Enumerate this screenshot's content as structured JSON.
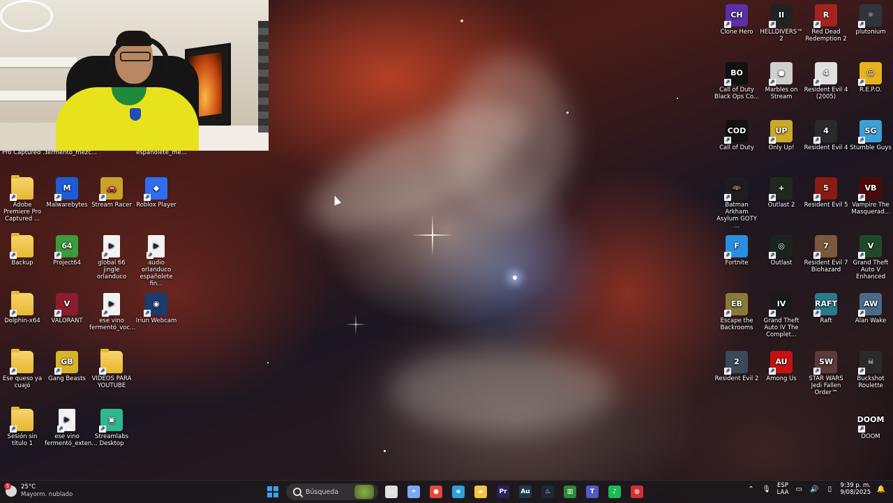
{
  "webcam": {
    "visible": true
  },
  "partial_labels": [
    "Pro Captured ...",
    "fermento_mezc...",
    "españolete_me..."
  ],
  "desktop_left": [
    {
      "label": "Adobe Premiere Pro Captured ...",
      "icon": "folder-icon",
      "type": "folder"
    },
    {
      "label": "Malwarebytes",
      "icon": "malwarebytes-icon",
      "color": "#1e5bd6",
      "glyph": "M"
    },
    {
      "label": "Stream Racer",
      "icon": "stream-racer-icon",
      "color": "#c9a22a",
      "glyph": "🚗"
    },
    {
      "label": "Roblox Player",
      "icon": "roblox-icon",
      "color": "#2f6ef0",
      "glyph": "◆"
    },
    {
      "label": "Backup",
      "icon": "folder-icon",
      "type": "folder"
    },
    {
      "label": "Project64",
      "icon": "project64-icon",
      "color": "#3a9c3a",
      "glyph": "64"
    },
    {
      "label": "global 66 jingle orlanduco",
      "icon": "audio-file-icon",
      "type": "doc",
      "glyph": "▶"
    },
    {
      "label": "audio orlanduco españolete fin...",
      "icon": "audio-file-icon",
      "type": "doc",
      "glyph": "▶"
    },
    {
      "label": "Dolphin-x64",
      "icon": "folder-icon",
      "type": "folder"
    },
    {
      "label": "VALORANT",
      "icon": "valorant-icon",
      "color": "#8b1c2c",
      "glyph": "V"
    },
    {
      "label": "ese vino fermentó_voc...",
      "icon": "audio-file-icon",
      "type": "doc",
      "glyph": "▶"
    },
    {
      "label": "Iriun Webcam",
      "icon": "iriun-webcam-icon",
      "color": "#1b3b6f",
      "glyph": "◉"
    },
    {
      "label": "Ese queso ya cuajó",
      "icon": "folder-icon",
      "type": "folder"
    },
    {
      "label": "Gang Beasts",
      "icon": "gang-beasts-icon",
      "color": "#d7b32a",
      "glyph": "GB"
    },
    {
      "label": "VIDEOS PARA YOUTUBE",
      "icon": "folder-icon",
      "type": "folder"
    },
    {
      "label": "Sesión sin título 1",
      "icon": "folder-icon",
      "type": "folder"
    },
    {
      "label": "ese vino fermentó_exten...",
      "icon": "audio-file-icon",
      "type": "doc",
      "glyph": "▶"
    },
    {
      "label": "Streamlabs Desktop",
      "icon": "streamlabs-icon",
      "color": "#2fb88f",
      "glyph": "▣"
    }
  ],
  "desktop_right": [
    {
      "label": "Clone Hero",
      "icon": "clone-hero-icon",
      "color": "#5a2fa8",
      "glyph": "CH"
    },
    {
      "label": "HELLDIVERS™ 2",
      "icon": "helldivers-icon",
      "color": "#222222",
      "glyph": "II"
    },
    {
      "label": "Red Dead Redemption 2",
      "icon": "rdr2-icon",
      "color": "#a3231f",
      "glyph": "R"
    },
    {
      "label": "plutonium",
      "icon": "plutonium-icon",
      "color": "#30343c",
      "glyph": "⚛"
    },
    {
      "label": "Call of Duty Black Ops Co...",
      "icon": "cod-bo-icon",
      "color": "#111111",
      "glyph": "BO"
    },
    {
      "label": "Marbles on Stream",
      "icon": "marbles-icon",
      "color": "#cfcfcf",
      "glyph": "●"
    },
    {
      "label": "Resident Evil 4 (2005)",
      "icon": "re4-2005-icon",
      "color": "#e0e0e0",
      "glyph": "4"
    },
    {
      "label": "R.E.P.O.",
      "icon": "repo-icon",
      "color": "#e6b31e",
      "glyph": "☺"
    },
    {
      "label": "Call of Duty",
      "icon": "cod-icon",
      "color": "#111111",
      "glyph": "COD"
    },
    {
      "label": "Only Up!",
      "icon": "only-up-icon",
      "color": "#c9a82a",
      "glyph": "UP"
    },
    {
      "label": "Resident Evil 4",
      "icon": "re4-icon",
      "color": "#2a2a2a",
      "glyph": "4"
    },
    {
      "label": "Stumble Guys",
      "icon": "stumble-guys-icon",
      "color": "#3aa0d8",
      "glyph": "SG"
    },
    {
      "label": "Batman Arkham Asylum GOTY ...",
      "icon": "batman-icon",
      "color": "#1d1d22",
      "glyph": "🦇"
    },
    {
      "label": "Outlast 2",
      "icon": "outlast2-icon",
      "color": "#1e2a1e",
      "glyph": "+"
    },
    {
      "label": "Resident Evil 5",
      "icon": "re5-icon",
      "color": "#8a1a12",
      "glyph": "5"
    },
    {
      "label": "Vampire The Masquerad...",
      "icon": "vampire-icon",
      "color": "#4a0a0a",
      "glyph": "VB"
    },
    {
      "label": "Fortnite",
      "icon": "fortnite-icon",
      "color": "#2a8fe0",
      "glyph": "F"
    },
    {
      "label": "Outlast",
      "icon": "outlast-icon",
      "color": "#1a241c",
      "glyph": "◎"
    },
    {
      "label": "Resident Evil 7 Biohazard",
      "icon": "re7-icon",
      "color": "#7a5a3a",
      "glyph": "7"
    },
    {
      "label": "Grand Theft Auto V Enhanced",
      "icon": "gtav-icon",
      "color": "#1f4a2a",
      "glyph": "V"
    },
    {
      "label": "Escape the Backrooms",
      "icon": "escape-backrooms-icon",
      "color": "#8a7a3a",
      "glyph": "EB"
    },
    {
      "label": "Grand Theft Auto IV The Complet...",
      "icon": "gtaiv-icon",
      "color": "#1a1a1a",
      "glyph": "IV"
    },
    {
      "label": "Raft",
      "icon": "raft-icon",
      "color": "#2a7a8a",
      "glyph": "RAFT"
    },
    {
      "label": "Alan Wake",
      "icon": "alan-wake-icon",
      "color": "#4a6a8a",
      "glyph": "AW"
    },
    {
      "label": "Resident Evil 2",
      "icon": "re2-icon",
      "color": "#3a4a5a",
      "glyph": "2"
    },
    {
      "label": "Among Us",
      "icon": "among-us-icon",
      "color": "#c51111",
      "glyph": "AU"
    },
    {
      "label": "STAR WARS Jedi Fallen Order™",
      "icon": "jedi-icon",
      "color": "#5a3a3a",
      "glyph": "SW"
    },
    {
      "label": "Buckshot Roulette",
      "icon": "buckshot-icon",
      "color": "#2a2a2a",
      "glyph": "☠"
    },
    {
      "label": "DOOM",
      "icon": "doom-icon",
      "color": "#00000000",
      "glyph": "DOOM"
    }
  ],
  "taskbar": {
    "weather_temp": "25°C",
    "weather_desc": "Mayorm. nublado",
    "weather_badge": "5",
    "search_placeholder": "Búsqueda",
    "apps": [
      {
        "name": "task-view",
        "glyph": "▭",
        "color": "#e0e0e0"
      },
      {
        "name": "copilot",
        "glyph": "✦",
        "color": "#7aa8ff"
      },
      {
        "name": "chrome",
        "glyph": "●",
        "color": "#e8453c"
      },
      {
        "name": "edge",
        "glyph": "e",
        "color": "#2aa4d8"
      },
      {
        "name": "file-explorer",
        "glyph": "▰",
        "color": "#f4c542"
      },
      {
        "name": "premiere-pro",
        "glyph": "Pr",
        "color": "#2a1f5a"
      },
      {
        "name": "audition",
        "glyph": "Au",
        "color": "#1a3a4a"
      },
      {
        "name": "steam",
        "glyph": "♨",
        "color": "#1b2838"
      },
      {
        "name": "xbox",
        "glyph": "▥",
        "color": "#2a8a3a"
      },
      {
        "name": "teams",
        "glyph": "T",
        "color": "#5059c9"
      },
      {
        "name": "spotify",
        "glyph": "♪",
        "color": "#1db954"
      },
      {
        "name": "epic-app",
        "glyph": "◍",
        "color": "#d03030"
      }
    ],
    "lang_top": "ESP",
    "lang_bottom": "LAA",
    "time": "9:39 p. m.",
    "date": "9/08/2025"
  }
}
